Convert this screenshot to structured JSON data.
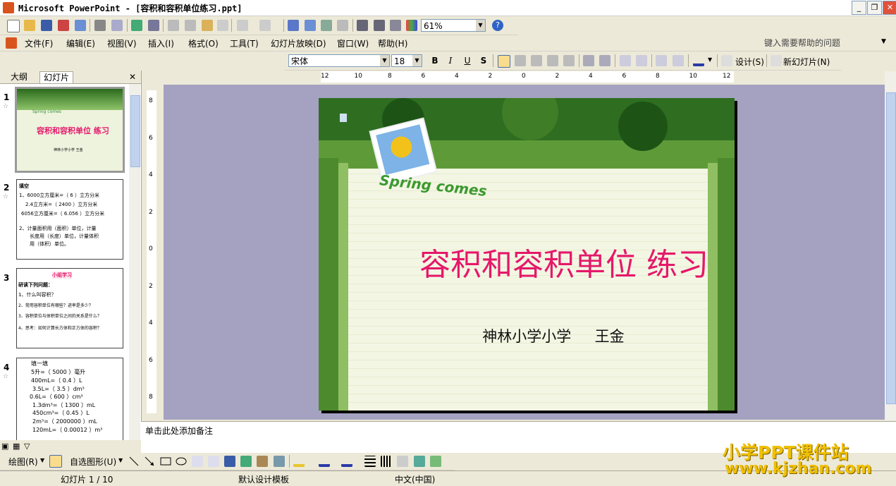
{
  "window": {
    "title": "Microsoft PowerPoint - [容积和容积单位练习.ppt]",
    "min": "_",
    "max": "❐",
    "close": "✕"
  },
  "toolbar": {
    "zoom": "61%",
    "help_icon": "?"
  },
  "menu": {
    "items": [
      "文件(F)",
      "编辑(E)",
      "视图(V)",
      "插入(I)",
      "格式(O)",
      "工具(T)",
      "幻灯片放映(D)",
      "窗口(W)",
      "帮助(H)"
    ],
    "help_placeholder": "键入需要帮助的问题"
  },
  "format": {
    "font": "宋体",
    "size": "18",
    "bold": "B",
    "italic": "I",
    "underline": "U",
    "shadow": "S",
    "design": "设计(S)",
    "new_slide": "新幻灯片(N)"
  },
  "panel": {
    "tab_outline": "大纲",
    "tab_slides": "幻灯片",
    "close": "✕"
  },
  "thumbs": [
    {
      "num": "1",
      "title": "容积和容积单位 练习",
      "logo": "Spring comes",
      "sub": "神林小学小学 王金"
    },
    {
      "num": "2",
      "lines": [
        "填空",
        "1、6000立方厘米=（ 6 ）立方分米",
        "2.4立方米=（ 2400 ）立方分米",
        "6056立方厘米=（ 6.056 ）立方分米",
        "2、计量面积用（面积）单位，计量",
        "长度用（长度）单位，计量体积",
        "用（体积）单位。"
      ]
    },
    {
      "num": "3",
      "heading": "小组学习",
      "lines": [
        "研读下列问题：",
        "1、什么叫容积？",
        "2、常用容积单位有哪些？进率是多少？",
        "3、容积单位与体积单位之间的关系是什么？",
        "4、思考：如何计算长方体和正方体的容积？"
      ]
    },
    {
      "num": "4",
      "lines": [
        "填一填",
        "5升=（ 5000 ）毫升",
        "400mL=（ 0.4 ）L",
        "3.5L=（ 3.5 ）dm³",
        "0.6L=（ 600 ）cm³",
        "1.3dm³=（ 1300 ）mL",
        "450cm³=（ 0.45 ）L",
        "2m³=（ 2000000 ）mL",
        "120mL=（ 0.00012 ）m³"
      ]
    }
  ],
  "rulers": {
    "h": [
      "12",
      "10",
      "8",
      "6",
      "4",
      "2",
      "0",
      "2",
      "4",
      "6",
      "8",
      "10",
      "12"
    ],
    "v": [
      "8",
      "6",
      "4",
      "2",
      "0",
      "2",
      "4",
      "6",
      "8"
    ]
  },
  "slide": {
    "logo": "Spring comes",
    "title": "容积和容积单位 练习",
    "subtitle": "神林小学小学     王金"
  },
  "notes": {
    "placeholder": "单击此处添加备注"
  },
  "draw": {
    "draw_label": "绘图(R)",
    "autoshape_label": "自选图形(U)"
  },
  "status": {
    "slide": "幻灯片 1 / 10",
    "template": "默认设计模板",
    "lang": "中文(中国)"
  },
  "watermark": {
    "line1": "小学PPT课件站",
    "line2": "www.kjzhan.com"
  },
  "colors": {
    "accent_title": "#e5186a",
    "canvas": "#a4a2c0",
    "chrome": "#ece9d8"
  }
}
